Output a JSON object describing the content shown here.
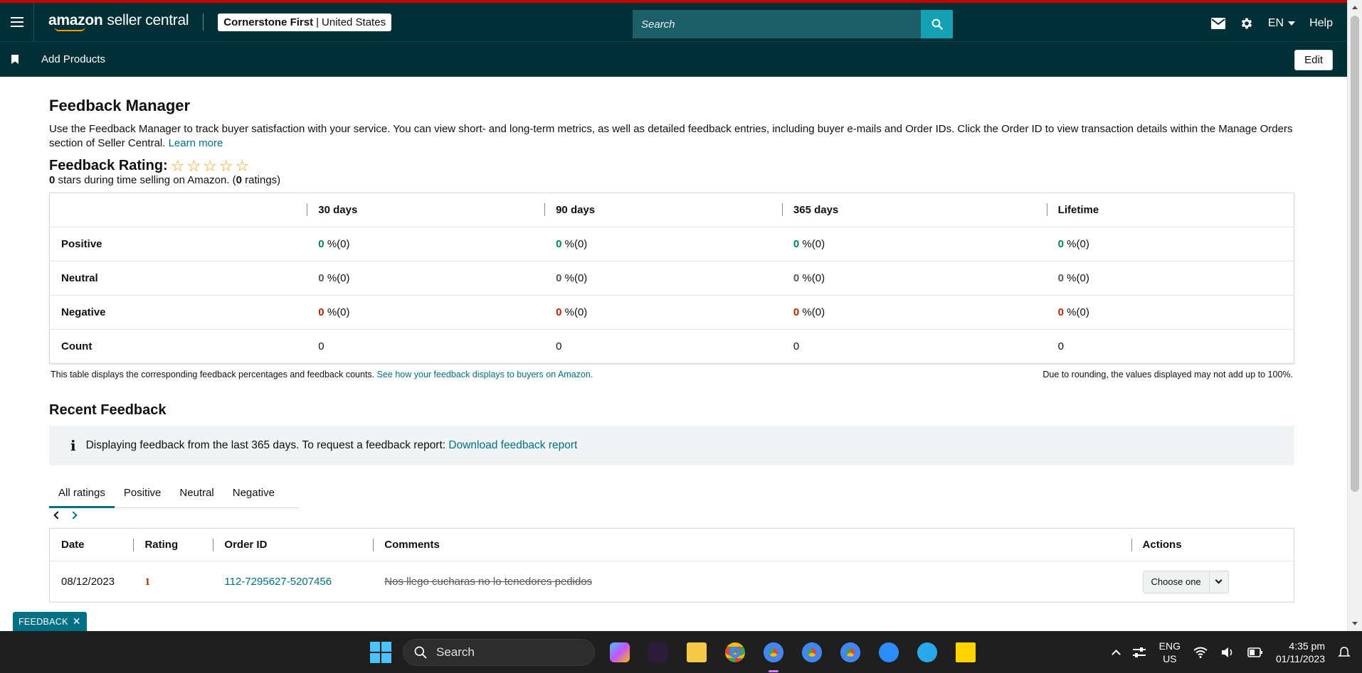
{
  "header": {
    "logo_word": "amazon",
    "logo_suffix": "seller central",
    "store_name": "Cornerstone First",
    "store_region": "United States",
    "search_placeholder": "Search",
    "lang": "EN",
    "help": "Help"
  },
  "bookbar": {
    "add_products": "Add Products",
    "edit": "Edit"
  },
  "page": {
    "title": "Feedback Manager",
    "intro": "Use the Feedback Manager to track buyer satisfaction with your service. You can view short- and long-term metrics, as well as detailed feedback entries, including buyer e-mails and Order IDs. Click the Order ID to view transaction details within the Manage Orders section of Seller Central.",
    "learn_more": "Learn more",
    "rating_label": "Feedback Rating:",
    "rating_stars": 0,
    "rating_sub_stars": "0",
    "rating_sub_mid": "stars during time selling on Amazon. (",
    "rating_sub_count": "0",
    "rating_sub_end": "ratings)"
  },
  "metrics": {
    "columns": [
      "30 days",
      "90 days",
      "365 days",
      "Lifetime"
    ],
    "rows": [
      {
        "label": "Positive",
        "values": [
          "0",
          "0",
          "0",
          "0"
        ],
        "suffix": "%(0)"
      },
      {
        "label": "Neutral",
        "values": [
          "0",
          "0",
          "0",
          "0"
        ],
        "suffix": "%(0)"
      },
      {
        "label": "Negative",
        "values": [
          "0",
          "0",
          "0",
          "0"
        ],
        "suffix": "%(0)"
      },
      {
        "label": "Count",
        "values": [
          "0",
          "0",
          "0",
          "0"
        ]
      }
    ],
    "note_left": "This table displays the corresponding feedback percentages and feedback counts.",
    "note_link": "See how your feedback displays to buyers on Amazon.",
    "note_right": "Due to rounding, the values displayed may not add up to 100%."
  },
  "recent": {
    "title": "Recent Feedback",
    "info_text": "Displaying feedback from the last 365 days. To request a feedback report:",
    "info_link": "Download feedback report",
    "tabs": [
      "All ratings",
      "Positive",
      "Neutral",
      "Negative"
    ],
    "table_headers": [
      "Date",
      "Rating",
      "Order ID",
      "Comments",
      "Actions"
    ],
    "rows": [
      {
        "date": "08/12/2023",
        "rating": "1",
        "order_id": "112-7295627-5207456",
        "comment": "Nos llego cucharas no lo tenedores pedidos",
        "action": "Choose one"
      }
    ]
  },
  "feedback_tag": "FEEDBACK",
  "taskbar": {
    "search": "Search",
    "lang_top": "ENG",
    "lang_bottom": "US",
    "time": "4:35 pm",
    "date": "01/11/2023"
  },
  "colors": {
    "header_bg": "#002f36",
    "accent_link": "#007185",
    "positive": "#067d62",
    "negative": "#b12704",
    "star": "#e3a417"
  }
}
